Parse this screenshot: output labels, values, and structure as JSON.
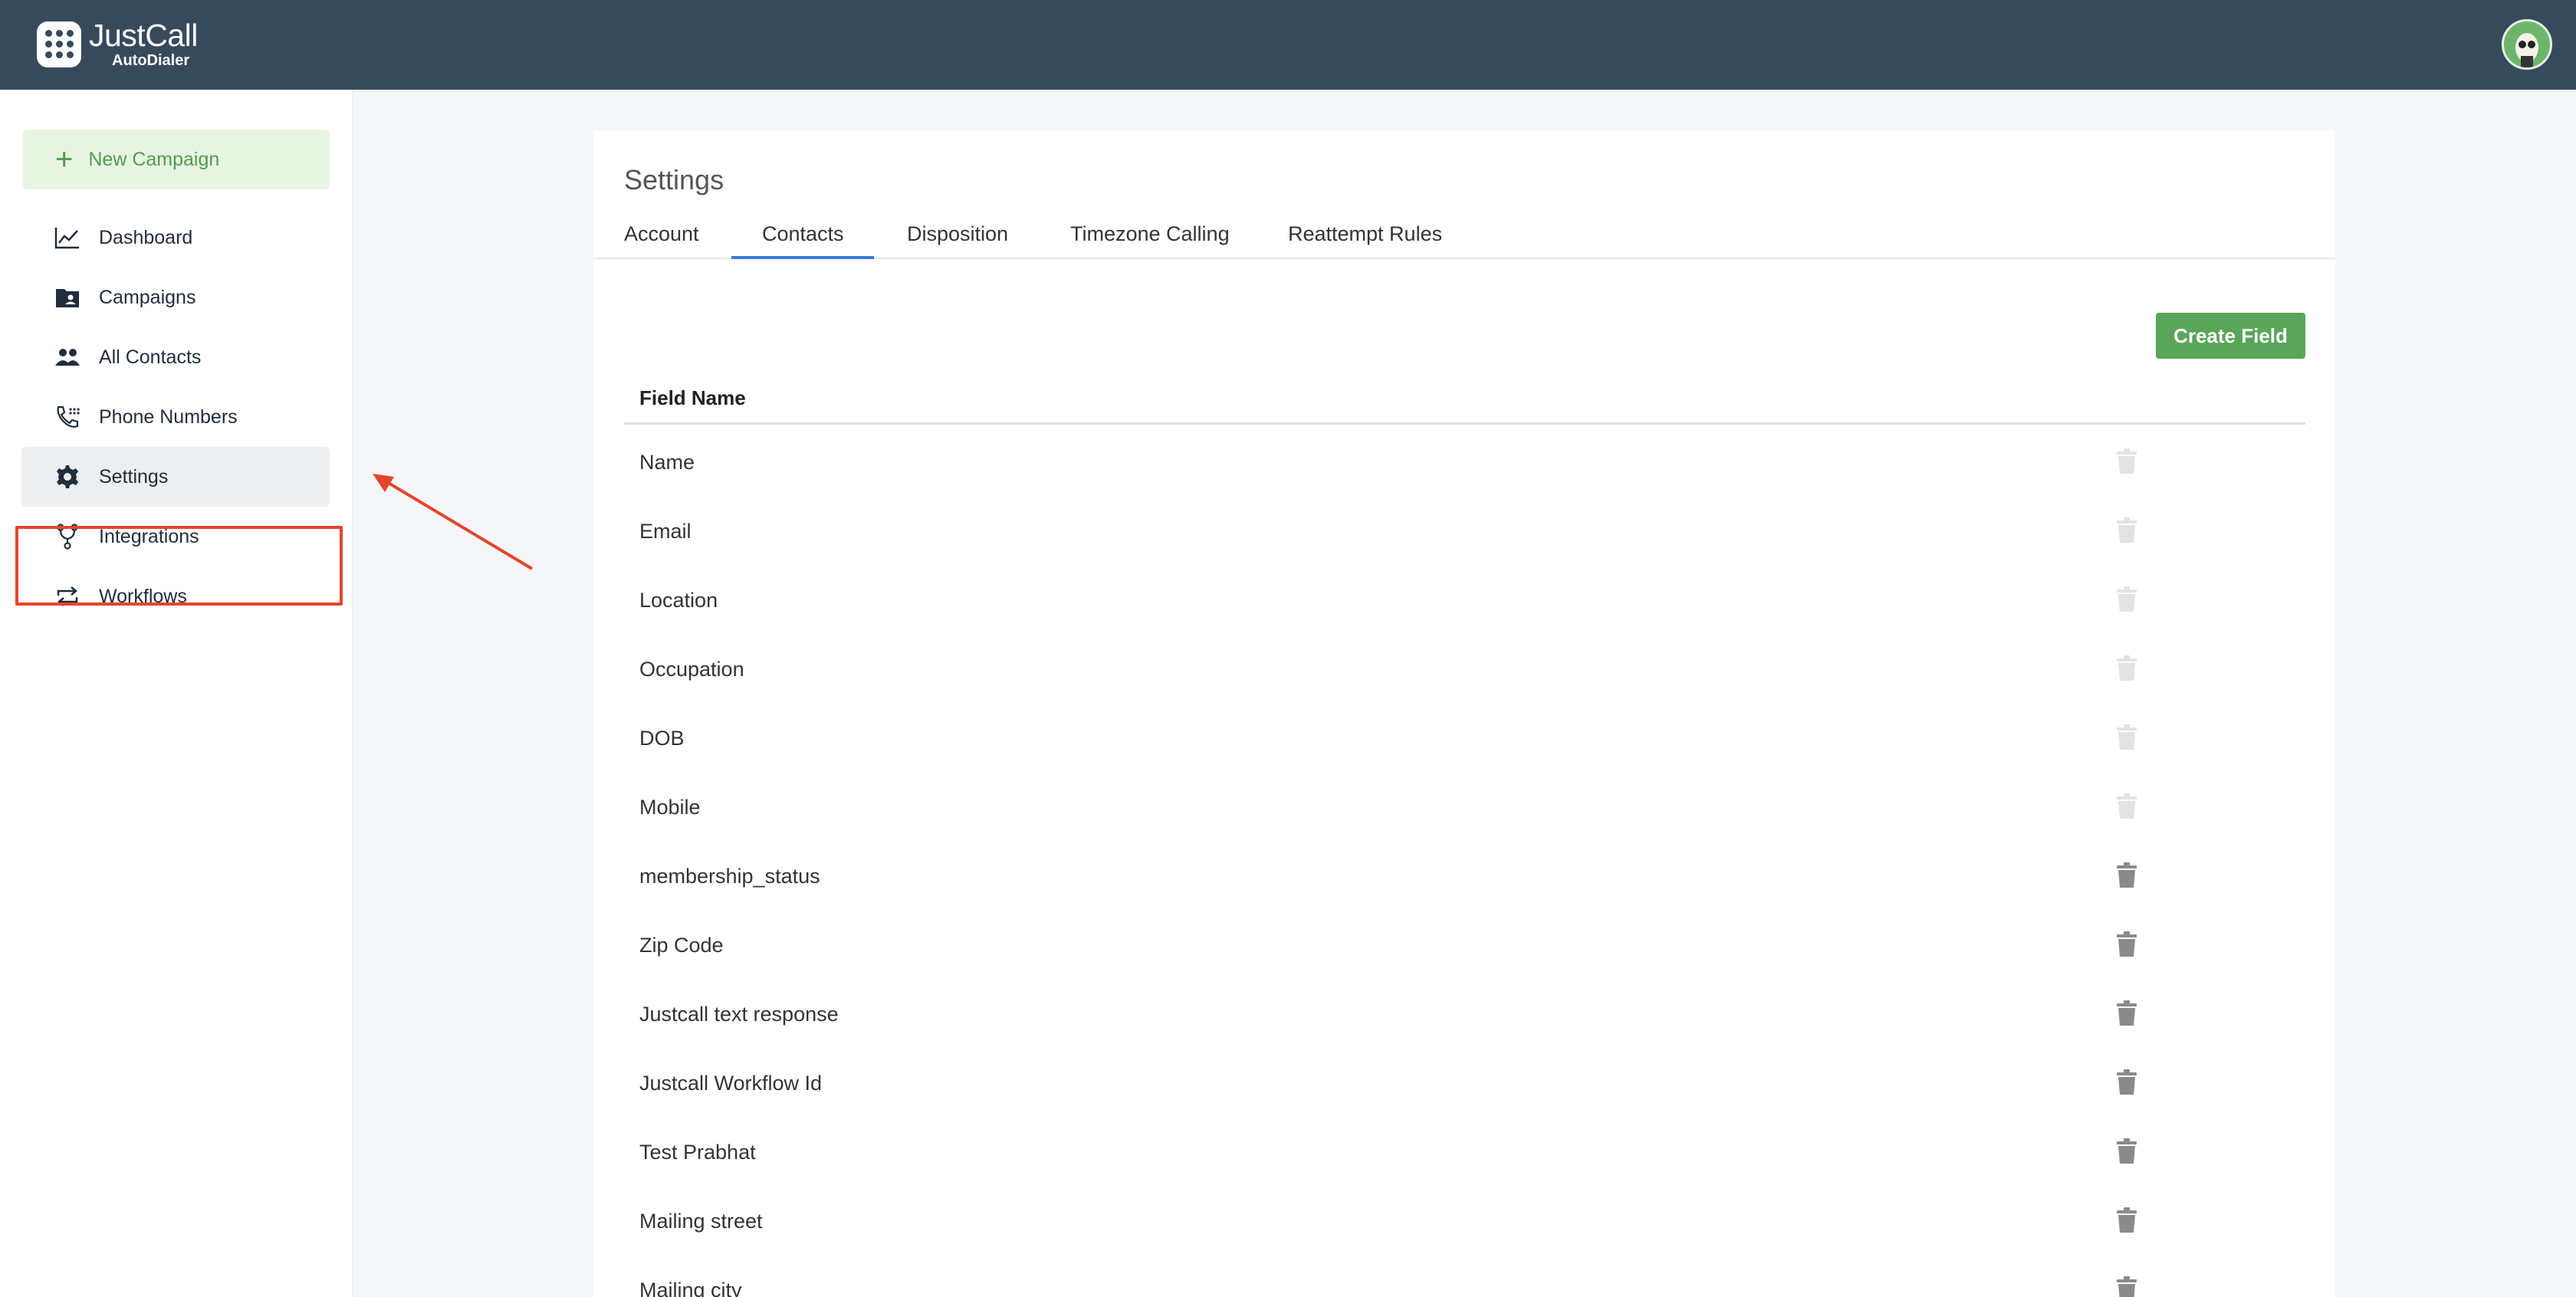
{
  "app": {
    "logo_main": "JustCall",
    "logo_sub": "AutoDialer"
  },
  "sidebar": {
    "new_campaign": "New Campaign",
    "items": [
      {
        "label": "Dashboard",
        "icon": "chart-line-icon"
      },
      {
        "label": "Campaigns",
        "icon": "folder-user-icon"
      },
      {
        "label": "All Contacts",
        "icon": "people-icon"
      },
      {
        "label": "Phone Numbers",
        "icon": "phone-dial-icon"
      },
      {
        "label": "Settings",
        "icon": "gear-icon",
        "active": true
      },
      {
        "label": "Integrations",
        "icon": "branch-icon"
      },
      {
        "label": "Workflows",
        "icon": "repeat-icon"
      }
    ]
  },
  "main": {
    "title": "Settings",
    "tabs": [
      {
        "label": "Account"
      },
      {
        "label": "Contacts",
        "active": true
      },
      {
        "label": "Disposition"
      },
      {
        "label": "Timezone Calling"
      },
      {
        "label": "Reattempt Rules"
      }
    ],
    "create_button": "Create Field",
    "table": {
      "column_header": "Field Name",
      "rows": [
        {
          "name": "Name",
          "deletable": false
        },
        {
          "name": "Email",
          "deletable": false
        },
        {
          "name": "Location",
          "deletable": false
        },
        {
          "name": "Occupation",
          "deletable": false
        },
        {
          "name": "DOB",
          "deletable": false
        },
        {
          "name": "Mobile",
          "deletable": false
        },
        {
          "name": "membership_status",
          "deletable": true
        },
        {
          "name": "Zip Code",
          "deletable": true
        },
        {
          "name": "Justcall text response",
          "deletable": true
        },
        {
          "name": "Justcall Workflow Id",
          "deletable": true
        },
        {
          "name": "Test Prabhat",
          "deletable": true
        },
        {
          "name": "Mailing street",
          "deletable": true
        },
        {
          "name": "Mailing city",
          "deletable": true
        }
      ]
    }
  },
  "colors": {
    "topbar": "#374a5c",
    "accent_green": "#5aa55a",
    "tab_active": "#3b7dd8",
    "annotation_red": "#e5452e"
  }
}
